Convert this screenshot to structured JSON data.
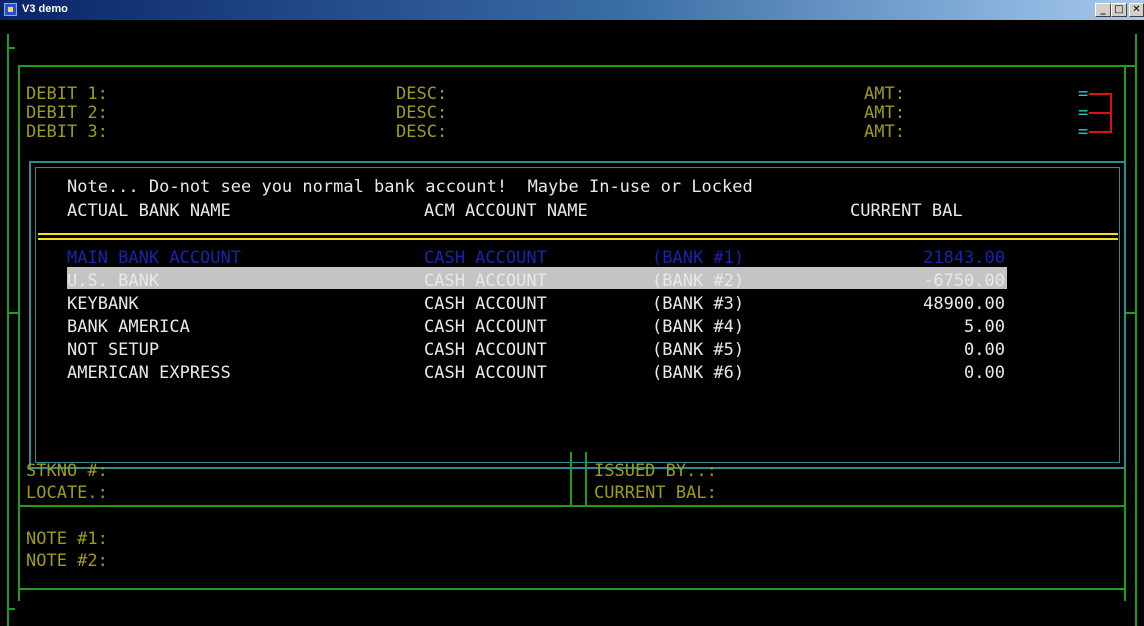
{
  "window": {
    "title": "V3 demo",
    "controls": {
      "minimize": "_",
      "maximize": "□",
      "close": "✕"
    }
  },
  "debits": [
    {
      "label": "DEBIT 1:",
      "desc": "DESC:",
      "amt": "AMT:",
      "marker": "="
    },
    {
      "label": "DEBIT 2:",
      "desc": "DESC:",
      "amt": "AMT:",
      "marker": "="
    },
    {
      "label": "DEBIT 3:",
      "desc": "DESC:",
      "amt": "AMT:",
      "marker": "="
    }
  ],
  "dialog": {
    "note": "Note... Do-not see you normal bank account!  Maybe In-use or Locked",
    "headers": {
      "bank_name": "ACTUAL BANK NAME",
      "acm_name": "ACM ACCOUNT NAME",
      "balance": "CURRENT BAL"
    },
    "selected_index": 0,
    "rows": [
      {
        "bank": "MAIN BANK ACCOUNT",
        "account": "CASH ACCOUNT",
        "bank_no": "(BANK #1)",
        "balance": "21843.00"
      },
      {
        "bank": "U.S. BANK",
        "account": "CASH ACCOUNT",
        "bank_no": "(BANK #2)",
        "balance": "-6750.00"
      },
      {
        "bank": "KEYBANK",
        "account": "CASH ACCOUNT",
        "bank_no": "(BANK #3)",
        "balance": "48900.00"
      },
      {
        "bank": "BANK AMERICA",
        "account": "CASH ACCOUNT",
        "bank_no": "(BANK #4)",
        "balance": "5.00"
      },
      {
        "bank": "NOT SETUP",
        "account": "CASH ACCOUNT",
        "bank_no": "(BANK #5)",
        "balance": "0.00"
      },
      {
        "bank": "AMERICAN EXPRESS",
        "account": "CASH ACCOUNT",
        "bank_no": "(BANK #6)",
        "balance": "0.00"
      }
    ]
  },
  "lower": {
    "stkno": "STKNO #:",
    "locate": "LOCATE.:",
    "issued_by": "ISSUED BY..:",
    "current_bal": "CURRENT BAL:",
    "note1": "NOTE #1:",
    "note2": "NOTE #2:"
  },
  "colors": {
    "olive_text": "#9c9c18",
    "cyan_text": "#1fd0d0",
    "border_green": "#1f9d1f",
    "dialog_teal": "#2a8e8e",
    "separator_yellow": "#f0e21e",
    "highlight_bg": "#c4c4c4",
    "highlight_text": "#1a22b0",
    "marker_red": "#e01010"
  }
}
